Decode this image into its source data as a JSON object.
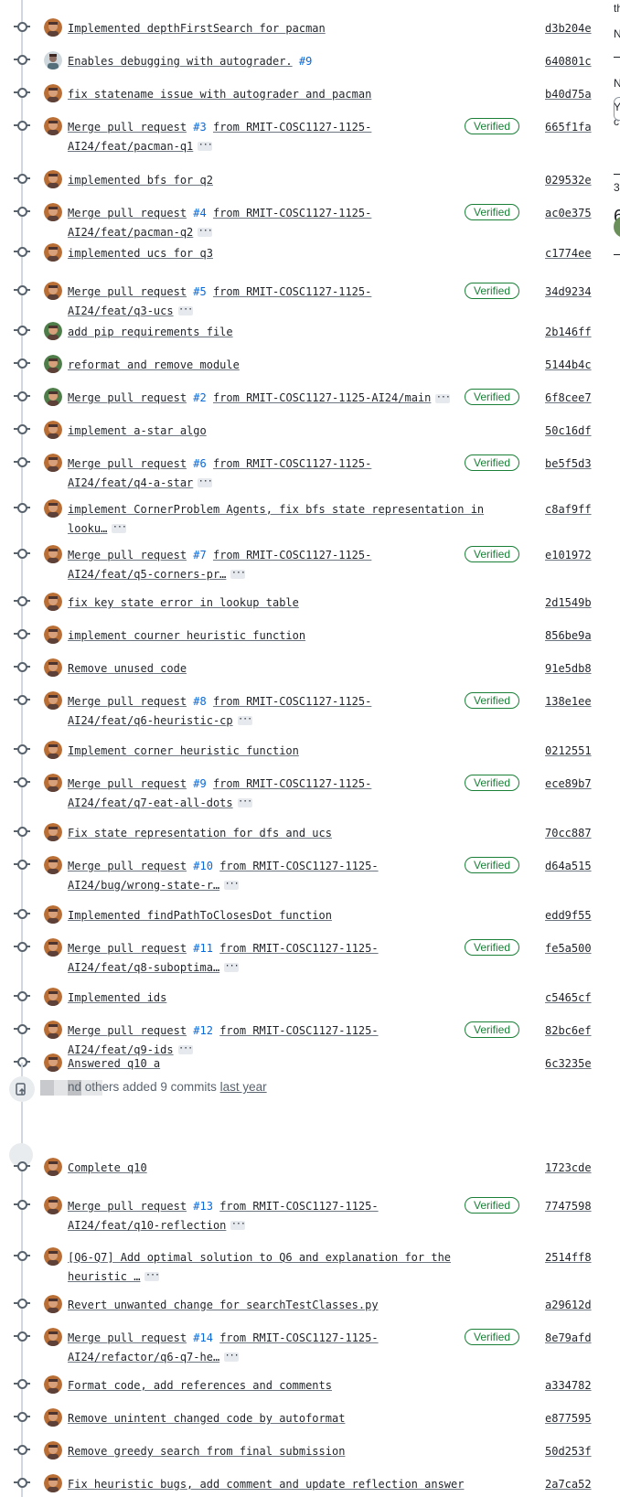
{
  "commits": [
    {
      "message": "Implemented depthFirstSearch for pacman",
      "sha": "d3b204e",
      "avatar": "orange"
    },
    {
      "message": "Enables debugging with autograder.",
      "pr": "#9",
      "sha": "640801c",
      "avatar": "person"
    },
    {
      "message": "fix statename issue with autograder and pacman",
      "sha": "b40d75a",
      "avatar": "orange"
    },
    {
      "message": "Merge pull request",
      "pr": "#3",
      "message_rest": "from RMIT-COSC1127-1125-AI24/feat/pacman-q1",
      "verified": true,
      "sha": "665f1fa",
      "avatar": "orange",
      "more": true
    },
    {
      "message": "implemented bfs for q2",
      "sha": "029532e",
      "avatar": "orange"
    },
    {
      "message": "Merge pull request",
      "pr": "#4",
      "message_rest": "from RMIT-COSC1127-1125-AI24/feat/pacman-q2",
      "verified": true,
      "sha": "ac0e375",
      "avatar": "orange",
      "more": true
    },
    {
      "message": "implemented ucs for q3",
      "sha": "c1774ee",
      "avatar": "orange"
    },
    {
      "message": "Merge pull request",
      "pr": "#5",
      "message_rest": "from RMIT-COSC1127-1125-AI24/feat/q3-ucs",
      "verified": true,
      "sha": "34d9234",
      "avatar": "orange",
      "more": true
    },
    {
      "message": "add pip requirements file",
      "sha": "2b146ff",
      "avatar": "green"
    },
    {
      "message": "reformat and remove module",
      "sha": "5144b4c",
      "avatar": "green"
    },
    {
      "message": "Merge pull request",
      "pr": "#2",
      "message_rest": "from RMIT-COSC1127-1125-AI24/main",
      "verified": true,
      "sha": "6f8cee7",
      "avatar": "green",
      "more": true
    },
    {
      "message": "implement a-star algo",
      "sha": "50c16df",
      "avatar": "orange"
    },
    {
      "message": "Merge pull request",
      "pr": "#6",
      "message_rest": "from RMIT-COSC1127-1125-AI24/feat/q4-a-star",
      "verified": true,
      "sha": "be5f5d3",
      "avatar": "orange",
      "more": true
    },
    {
      "message": "implement CornerProblem Agents, fix bfs state representation in looku…",
      "sha": "c8af9ff",
      "avatar": "orange",
      "more": true
    },
    {
      "message": "Merge pull request",
      "pr": "#7",
      "message_rest": "from RMIT-COSC1127-1125-AI24/feat/q5-corners-pr…",
      "verified": true,
      "sha": "e101972",
      "avatar": "orange",
      "more": true
    },
    {
      "message": "fix key state error in lookup table",
      "sha": "2d1549b",
      "avatar": "orange"
    },
    {
      "message": "implement courner heuristic function",
      "sha": "856be9a",
      "avatar": "orange"
    },
    {
      "message": "Remove unused code",
      "sha": "91e5db8",
      "avatar": "orange"
    },
    {
      "message": "Merge pull request",
      "pr": "#8",
      "message_rest": "from RMIT-COSC1127-1125-AI24/feat/q6-heuristic-cp",
      "verified": true,
      "sha": "138e1ee",
      "avatar": "orange",
      "more": true
    },
    {
      "message": "Implement corner heuristic function",
      "sha": "0212551",
      "avatar": "orange"
    },
    {
      "message": "Merge pull request",
      "pr": "#9",
      "message_rest": "from RMIT-COSC1127-1125-AI24/feat/q7-eat-all-dots",
      "verified": true,
      "sha": "ece89b7",
      "avatar": "orange",
      "more": true
    },
    {
      "message": "Fix state representation for dfs and ucs",
      "sha": "70cc887",
      "avatar": "orange"
    },
    {
      "message": "Merge pull request",
      "pr": "#10",
      "message_rest": "from RMIT-COSC1127-1125-AI24/bug/wrong-state-r…",
      "verified": true,
      "sha": "d64a515",
      "avatar": "orange",
      "more": true
    },
    {
      "message": "Implemented findPathToClosesDot function",
      "sha": "edd9f55",
      "avatar": "orange"
    },
    {
      "message": "Merge pull request",
      "pr": "#11",
      "message_rest": "from RMIT-COSC1127-1125-AI24/feat/q8-suboptima…",
      "verified": true,
      "sha": "fe5a500",
      "avatar": "orange",
      "more": true
    },
    {
      "message": "Implemented ids",
      "sha": "c5465cf",
      "avatar": "orange"
    },
    {
      "message": "Merge pull request",
      "pr": "#12",
      "message_rest": "from RMIT-COSC1127-1125-AI24/feat/q9-ids",
      "verified": true,
      "sha": "82bc6ef",
      "avatar": "orange",
      "more": true
    },
    {
      "message": "Answered q10 a",
      "sha": "6c3235e",
      "avatar": "orange"
    }
  ],
  "event": {
    "text": "nd others added 9 commits",
    "link": "last year"
  },
  "commits2": [
    {
      "message": "Complete q10",
      "sha": "1723cde",
      "avatar": "orange"
    },
    {
      "message": "Merge pull request",
      "pr": "#13",
      "message_rest": "from RMIT-COSC1127-1125-AI24/feat/q10-reflection",
      "verified": true,
      "sha": "7747598",
      "avatar": "orange",
      "more": true
    },
    {
      "message": "[Q6-Q7] Add optimal solution to Q6 and explanation for the heuristic …",
      "sha": "2514ff8",
      "avatar": "orange",
      "more": true
    },
    {
      "message": "Revert unwanted change for searchTestClasses.py",
      "sha": "a29612d",
      "avatar": "orange"
    },
    {
      "message": "Merge pull request",
      "pr": "#14",
      "message_rest": "from RMIT-COSC1127-1125-AI24/refactor/q6-q7-he…",
      "verified": true,
      "sha": "8e79afd",
      "avatar": "orange",
      "more": true
    },
    {
      "message": "Format code, add references and comments",
      "sha": "a334782",
      "avatar": "orange"
    },
    {
      "message": "Remove unintent changed code by autoformat",
      "sha": "e877595",
      "avatar": "orange"
    },
    {
      "message": "Remove greedy search from final submission",
      "sha": "50d253f",
      "avatar": "orange"
    },
    {
      "message": "Fix heuristic bugs, add comment and update reflection answer",
      "sha": "2a7ca52",
      "avatar": "orange"
    }
  ],
  "labels": {
    "verified": "Verified",
    "more": "···"
  },
  "sidebar_fragments": [
    "th",
    "N",
    "N",
    "Y",
    "c",
    "3",
    "6"
  ],
  "colors": {
    "pr_link": "#0969da",
    "verified": "#1a7f37",
    "timeline": "#d0d7de"
  }
}
